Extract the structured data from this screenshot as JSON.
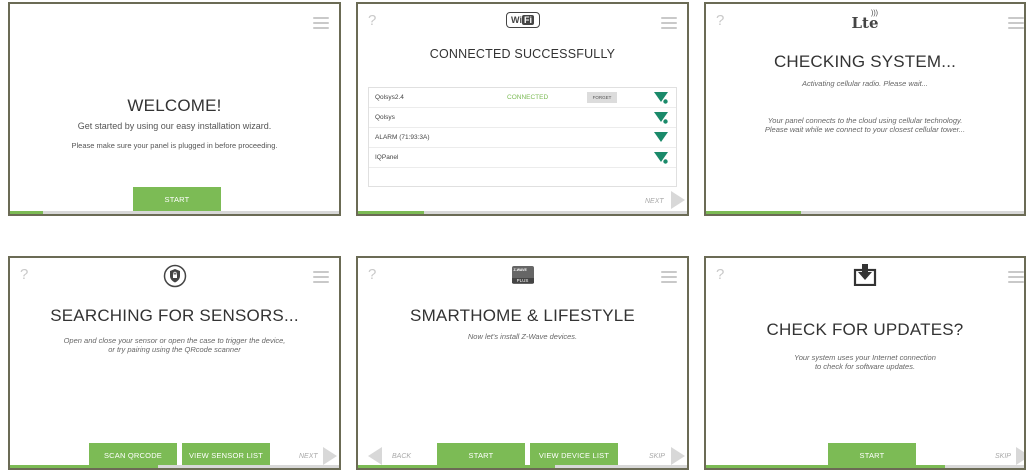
{
  "screens": {
    "welcome": {
      "title": "WELCOME!",
      "subtitle": "Get started by using our easy installation wizard.",
      "note": "Please make sure your panel is plugged in before proceeding.",
      "start_label": "START",
      "progress": 0.1
    },
    "wifi": {
      "logo_text": "Wi",
      "logo_text2": "Fi",
      "title": "CONNECTED SUCCESSFULLY",
      "networks": [
        {
          "name": "Qolsys2.4",
          "status": "CONNECTED",
          "action": "FORGET"
        },
        {
          "name": "Qolsys",
          "status": "",
          "action": ""
        },
        {
          "name": "ALARM (71:93:3A)",
          "status": "",
          "action": ""
        },
        {
          "name": "IQPanel",
          "status": "",
          "action": ""
        }
      ],
      "next_label": "NEXT",
      "progress": 0.2
    },
    "lte": {
      "logo_text": "Lte",
      "title": "CHECKING SYSTEM...",
      "subtitle": "Activating cellular radio. Please wait...",
      "note_line1": "Your panel connects to the cloud using cellular technology.",
      "note_line2": "Please wait while we connect to your closest cellular tower...",
      "progress": 0.3
    },
    "sensors": {
      "title": "SEARCHING FOR SENSORS...",
      "line1": "Open and close your sensor or open the case to trigger the device,",
      "line2": "or try pairing using the QRcode scanner",
      "scan_label": "SCAN QRCODE",
      "view_label": "VIEW SENSOR LIST",
      "next_label": "NEXT",
      "progress": 0.45
    },
    "smarthome": {
      "logo_text": "Z-WAVE",
      "logo_plus": "PLUS",
      "title": "SMARTHOME & LIFESTYLE",
      "subtitle": "Now let's install Z-Wave devices.",
      "back_label": "BACK",
      "start_label": "START",
      "view_label": "VIEW DEVICE LIST",
      "skip_label": "SKIP",
      "progress": 0.6
    },
    "updates": {
      "title": "CHECK FOR UPDATES?",
      "line1": "Your system uses your Internet connection",
      "line2": "to check for software updates.",
      "start_label": "START",
      "skip_label": "SKIP",
      "progress": 0.75
    }
  },
  "help_label": "?",
  "colors": {
    "accent": "#7cbb55",
    "border": "#6b6b55",
    "wifi_icon": "#1a8a6a",
    "track": "#d8d8d8"
  }
}
